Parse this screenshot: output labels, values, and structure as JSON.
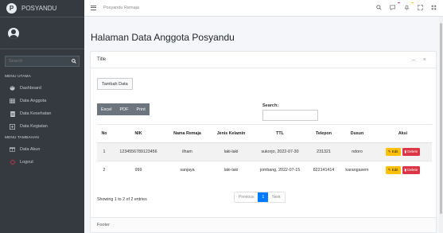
{
  "sidebar": {
    "brand_logo": "P",
    "brand_text": "POSYANDU",
    "search_placeholder": "Search",
    "header_utama": "MENU UTAMA",
    "header_tambahan": "MENU TAMBAHAN",
    "items": [
      {
        "label": "Dashboard",
        "icon": "palette-icon"
      },
      {
        "label": "Data Anggota",
        "icon": "table-icon"
      },
      {
        "label": "Data Kesehatan",
        "icon": "file-icon"
      },
      {
        "label": "Data Kegiatan",
        "icon": "plus-box-icon"
      },
      {
        "label": "Data Akun",
        "icon": "columns-icon"
      },
      {
        "label": "Logout",
        "icon": "circle-icon"
      }
    ]
  },
  "topbar": {
    "breadcrumb": "Posyandu Remaja",
    "badge_colors": {
      "warning": "#ffc107",
      "danger": "#dc3545"
    }
  },
  "page": {
    "title": "Halaman Data Anggota Posyandu"
  },
  "card": {
    "header_title": "Title",
    "tools": "– ×",
    "tambah_label": "Tambah Data",
    "export": [
      "Excel",
      "PDF",
      "Print"
    ],
    "search_label": "Search:",
    "footer": "Footer"
  },
  "table": {
    "headers": [
      "No",
      "NIK",
      "Nama Remaja",
      "Jenis Kelamin",
      "TTL",
      "Telepon",
      "Dusun",
      "Aksi"
    ],
    "rows": [
      [
        "1",
        "1234556789123456",
        "ilham",
        "laki-laki",
        "sukorjo, 2022-07-30",
        "231321",
        "ndoro"
      ],
      [
        "2",
        "999",
        "sanjaya",
        "laki-laki",
        "jombang, 2022-07-15",
        "822141414",
        "karangasem"
      ]
    ],
    "edit_label": "Edit",
    "delete_label": "Delete",
    "info": "Showing 1 to 2 of 2 entries",
    "pager": {
      "previous": "Previous",
      "current": "1",
      "next": "Next"
    }
  }
}
